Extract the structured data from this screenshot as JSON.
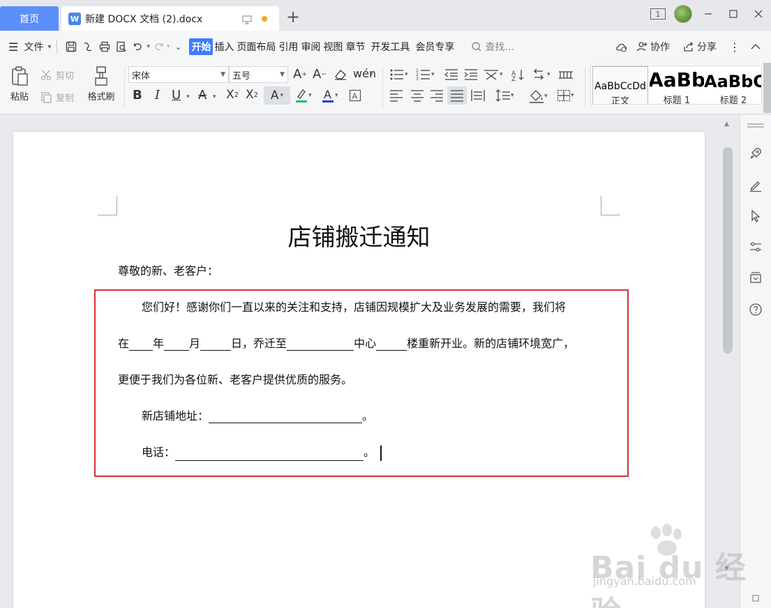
{
  "tabs": {
    "home_label": "首页",
    "doc_icon": "W",
    "doc_title": "新建 DOCX 文档 (2).docx",
    "new_tab_symbol": "+"
  },
  "window": {
    "page_badge": "1"
  },
  "menubar": {
    "file_label": "文件",
    "tabs": [
      "开始",
      "插入",
      "页面布局",
      "引用",
      "审阅",
      "视图",
      "章节",
      "开发工具",
      "会员专享"
    ],
    "active_tab": "开始",
    "search_placeholder": "查找...",
    "collab_label": "协作",
    "share_label": "分享"
  },
  "ribbon": {
    "paste_label": "粘贴",
    "cut_label": "剪切",
    "copy_label": "复制",
    "format_painter_label": "格式刷",
    "font_name": "宋体",
    "font_size": "五号",
    "phonetic_glyph": "wén",
    "styles": [
      {
        "preview": "AaBbCcDd",
        "label": "正文"
      },
      {
        "preview": "AaBb",
        "label": "标题 1"
      },
      {
        "preview": "AaBbC",
        "label": "标题 2"
      }
    ]
  },
  "document": {
    "heading": "店铺搬迁通知",
    "salutation": "尊敬的新、老客户：",
    "line1": "您们好！感谢你们一直以来的关注和支持，店铺因规模扩大及业务发展的需要，我们将",
    "line2": {
      "p1": "在",
      "p2": "年",
      "p3": "月",
      "p4": "日，乔迁至",
      "p5": "中心",
      "p6": "楼重新开业。新的店铺环境宽广，"
    },
    "line3": "更便于我们为各位新、老客户提供优质的服务。",
    "address_label": "新店铺地址：",
    "phone_label": "电话：",
    "period": "。"
  },
  "watermark": {
    "main": "Bai du 经验",
    "sub": "jingyan.baidu.com"
  },
  "colors": {
    "accent": "#3b7cff",
    "home_tab": "#5b8ff9",
    "highlight_border": "#d93030",
    "unsaved_dot": "#f5a623"
  }
}
